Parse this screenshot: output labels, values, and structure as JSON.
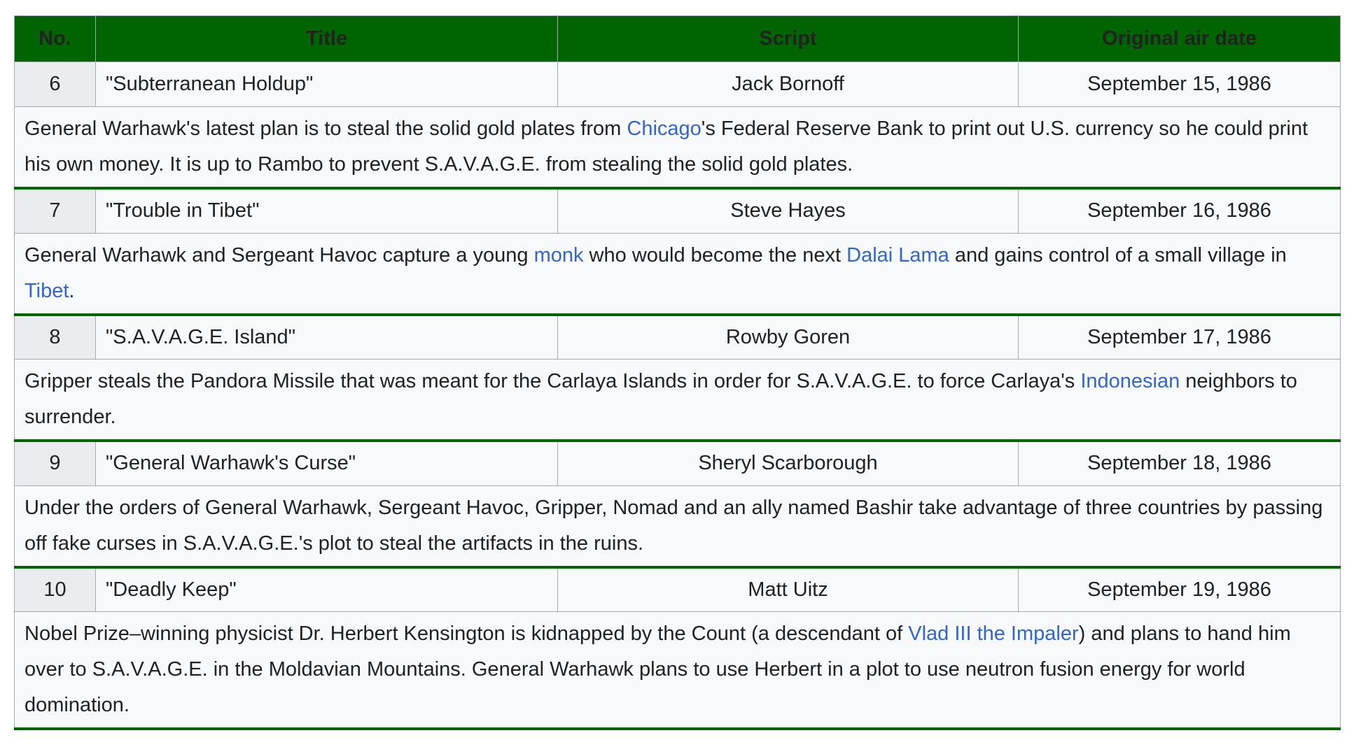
{
  "header": {
    "no": "No.",
    "title": "Title",
    "script": "Script",
    "air_date": "Original air date"
  },
  "colors": {
    "header_bg": "#006400",
    "link": "#3366cc",
    "row_bg": "#f8f9fa",
    "number_cell_bg": "#eaecf0",
    "separator": "#006400"
  },
  "episodes": [
    {
      "no": "6",
      "title": "\"Subterranean Holdup\"",
      "script": "Jack Bornoff",
      "air_date": "September 15, 1986",
      "summary": [
        {
          "text": "General Warhawk's latest plan is to steal the solid gold plates from "
        },
        {
          "text": "Chicago",
          "link": true
        },
        {
          "text": "'s Federal Reserve Bank to print out U.S. currency so he could print his own money. It is up to Rambo to prevent S.A.V.A.G.E. from stealing the solid gold plates."
        }
      ]
    },
    {
      "no": "7",
      "title": "\"Trouble in Tibet\"",
      "script": "Steve Hayes",
      "air_date": "September 16, 1986",
      "summary": [
        {
          "text": "General Warhawk and Sergeant Havoc capture a young "
        },
        {
          "text": "monk",
          "link": true
        },
        {
          "text": " who would become the next "
        },
        {
          "text": "Dalai Lama",
          "link": true
        },
        {
          "text": " and gains control of a small village in "
        },
        {
          "text": "Tibet",
          "link": true
        },
        {
          "text": "."
        }
      ]
    },
    {
      "no": "8",
      "title": "\"S.A.V.A.G.E. Island\"",
      "script": "Rowby Goren",
      "air_date": "September 17, 1986",
      "summary": [
        {
          "text": "Gripper steals the Pandora Missile that was meant for the Carlaya Islands in order for S.A.V.A.G.E. to force Carlaya's "
        },
        {
          "text": "Indonesian",
          "link": true
        },
        {
          "text": " neighbors to surrender."
        }
      ]
    },
    {
      "no": "9",
      "title": "\"General Warhawk's Curse\"",
      "script": "Sheryl Scarborough",
      "air_date": "September 18, 1986",
      "summary": [
        {
          "text": "Under the orders of General Warhawk, Sergeant Havoc, Gripper, Nomad and an ally named Bashir take advantage of three countries by passing off fake curses in S.A.V.A.G.E.'s plot to steal the artifacts in the ruins."
        }
      ]
    },
    {
      "no": "10",
      "title": "\"Deadly Keep\"",
      "script": "Matt Uitz",
      "air_date": "September 19, 1986",
      "summary": [
        {
          "text": "Nobel Prize–winning physicist Dr. Herbert Kensington is kidnapped by the Count (a descendant of "
        },
        {
          "text": "Vlad III the Impaler",
          "link": true
        },
        {
          "text": ") and plans to hand him over to S.A.V.A.G.E. in the Moldavian Mountains. General Warhawk plans to use Herbert in a plot to use neutron fusion energy for world domination."
        }
      ]
    }
  ]
}
